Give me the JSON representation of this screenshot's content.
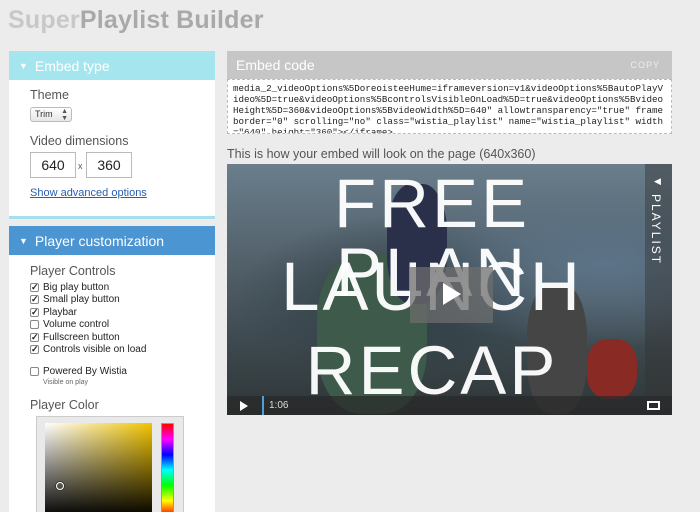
{
  "app": {
    "title_light": "Super",
    "title_dark": "Playlist Builder"
  },
  "embed_type": {
    "header": "Embed type",
    "theme_label": "Theme",
    "theme_value": "Trim",
    "dimensions_label": "Video dimensions",
    "width": "640",
    "separator": "x",
    "height": "360",
    "advanced_link": "Show advanced options"
  },
  "player": {
    "header": "Player customization",
    "controls_label": "Player Controls",
    "controls": [
      {
        "label": "Big play button",
        "checked": true
      },
      {
        "label": "Small play button",
        "checked": true
      },
      {
        "label": "Playbar",
        "checked": true
      },
      {
        "label": "Volume control",
        "checked": false
      },
      {
        "label": "Fullscreen button",
        "checked": true
      },
      {
        "label": "Controls visible on load",
        "checked": true
      }
    ],
    "powered_label": "Powered By Wistia",
    "powered_checked": false,
    "powered_sub": "Visible on play",
    "color_label": "Player Color"
  },
  "embed_code": {
    "header": "Embed code",
    "copy": "COPY",
    "code": "media_2_videoOptions%5DoreoisteeHume=iframeversion=v1&videoOptions%5BautoPlayVideo%5D=true&videoOptions%5BcontrolsVisibleOnLoad%5D=true&videoOptions%5BvideoHeight%5D=360&videoOptions%5BvideoWidth%5D=640\" allowtransparency=\"true\" frameborder=\"0\" scrolling=\"no\" class=\"wistia_playlist\" name=\"wistia_playlist\" width=\"640\" height=\"360\"></iframe>",
    "preview_caption": "This is how your embed will look on the page (640x360)"
  },
  "video": {
    "overlay_lines": [
      "FREE PLAN",
      "LAUNCH",
      "RECAP"
    ],
    "playlist_label": "PLAYLIST",
    "time": "1:06"
  }
}
